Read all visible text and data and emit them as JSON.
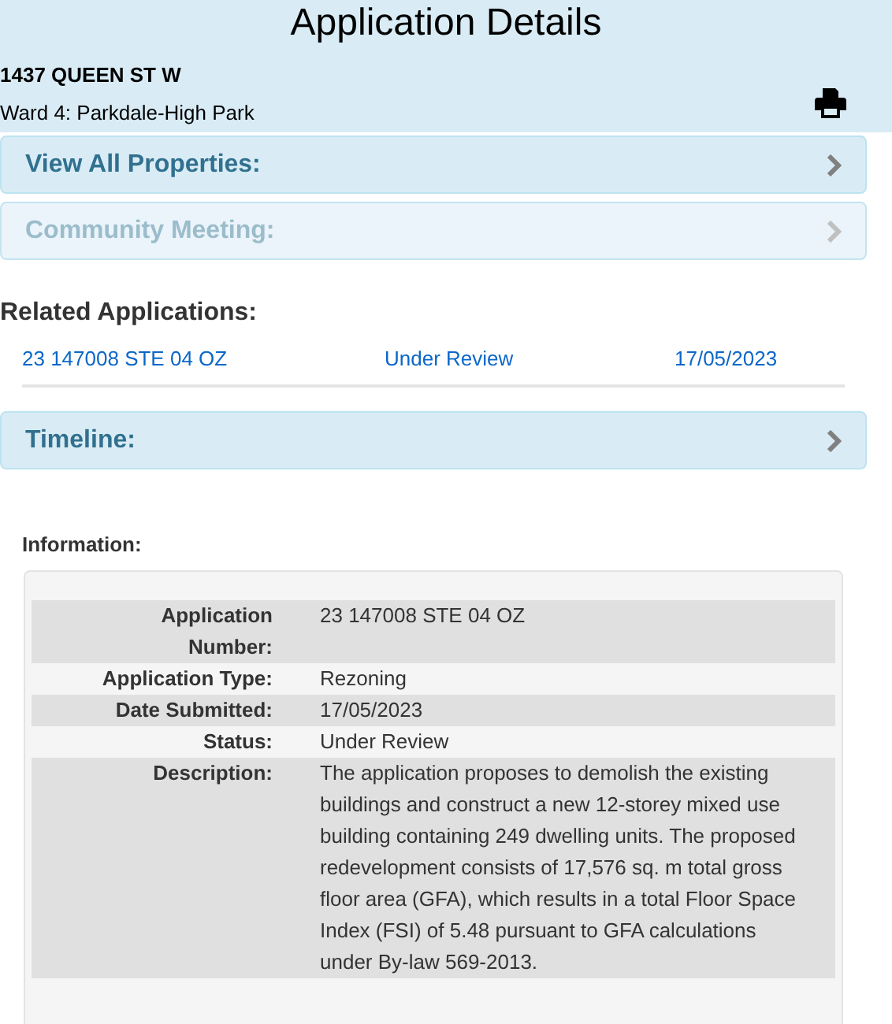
{
  "header": {
    "title": "Application Details",
    "address": "1437 QUEEN ST W",
    "ward": "Ward 4: Parkdale-High Park"
  },
  "panels": [
    {
      "label": "View All Properties:",
      "disabled": false
    },
    {
      "label": "Community Meeting:",
      "disabled": true
    }
  ],
  "related_applications": {
    "heading": "Related Applications:",
    "rows": [
      {
        "number": "23 147008 STE 04 OZ",
        "status": "Under Review",
        "date": "17/05/2023"
      }
    ]
  },
  "timeline_panel": {
    "label": "Timeline:",
    "disabled": false
  },
  "information": {
    "heading": "Information:",
    "rows": [
      {
        "label": "Application Number:",
        "value": "23 147008 STE 04 OZ"
      },
      {
        "label": "Application Type:",
        "value": "Rezoning"
      },
      {
        "label": "Date Submitted:",
        "value": "17/05/2023"
      },
      {
        "label": "Status:",
        "value": "Under Review"
      },
      {
        "label": "Description:",
        "value": "The application proposes to demolish the existing buildings and construct a new 12-storey mixed use building containing 249 dwelling units. The proposed redevelopment consists of 17,576 sq. m total gross floor area (GFA), which results in a total Floor Space Index (FSI) of 5.48 pursuant to GFA calculations under By-law 569-2013."
      }
    ]
  }
}
